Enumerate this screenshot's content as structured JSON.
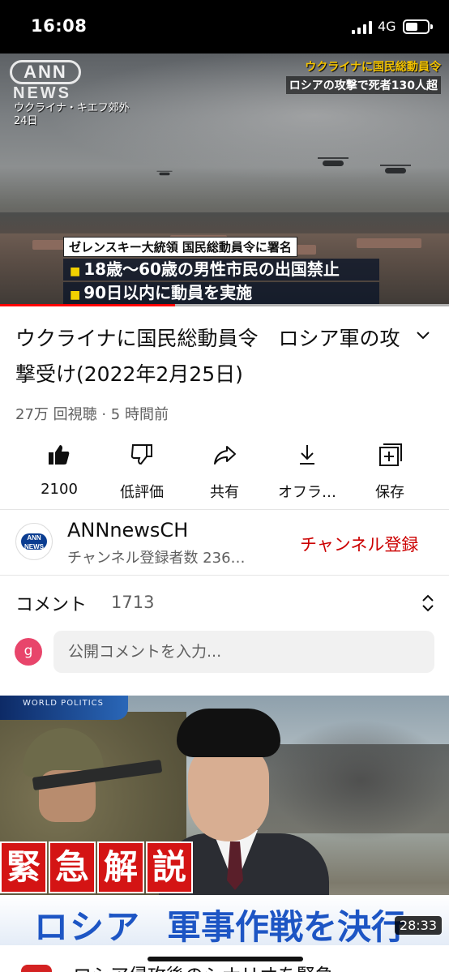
{
  "status_bar": {
    "time": "16:08",
    "network": "4G"
  },
  "video": {
    "logo_top": "ANN",
    "logo_bottom": "NEWS",
    "location_line1": "ウクライナ・キエフ郊外",
    "location_line2": "24日",
    "corner_line1": "ウクライナに国民総動員令",
    "corner_line2": "ロシアの攻撃で死者130人超",
    "lower_head": "ゼレンスキー大統領 国民総動員令に署名",
    "lower_line1": "18歳～60歳の男性市民の出国禁止",
    "lower_line2": "90日以内に動員を実施",
    "progress": 0.39
  },
  "title": "ウクライナに国民総動員令　ロシア軍の攻撃受け(2022年2月25日)",
  "meta": "27万 回視聴 · 5 時間前",
  "actions": {
    "like": "2100",
    "dislike": "低評価",
    "share": "共有",
    "offline": "オフラ…",
    "save": "保存"
  },
  "channel": {
    "avatar_top": "ANN",
    "avatar_bottom": "NEWS",
    "name": "ANNnewsCH",
    "subs": "チャンネル登録者数 236…",
    "subscribe": "チャンネル登録"
  },
  "comments": {
    "title": "コメント",
    "count": "1713",
    "avatar_letter": "g",
    "placeholder": "公開コメントを入力..."
  },
  "next_video": {
    "badge": "WORLD POLITICS",
    "kanji": [
      "緊",
      "急",
      "解",
      "説"
    ],
    "banner_left": "ロシア",
    "banner_right": "軍事作戦を決行",
    "duration": "28:33",
    "next_title": "ロシア侵攻後のシナリオを緊急…"
  },
  "colors": {
    "accent_red": "#cc0000",
    "progress_red": "#ff0000",
    "avatar_pink": "#e8456b"
  },
  "icons": {
    "like": "thumb-up-icon",
    "dislike": "thumb-down-icon",
    "share": "share-icon",
    "offline": "download-icon",
    "save": "playlist-add-icon",
    "expand": "chevron-down-icon",
    "sort": "sort-icon"
  }
}
